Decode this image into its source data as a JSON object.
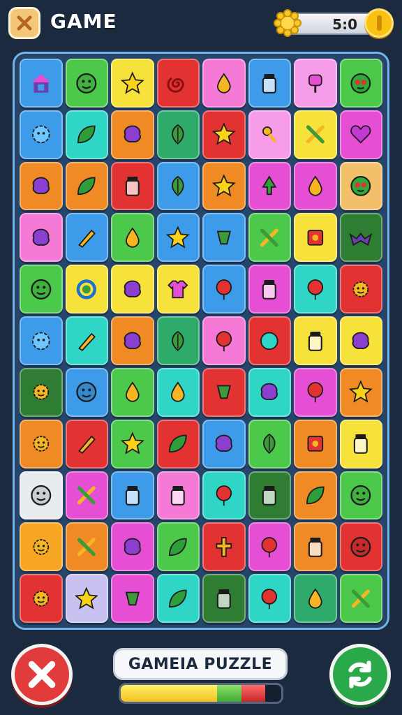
{
  "header": {
    "title": "GAME",
    "score": "5:0",
    "close_icon": "close-icon",
    "badge_icon": "gear-badge-icon",
    "coin_icon": "coin-icon"
  },
  "footer": {
    "puzzle_label": "GAMEIA PUZZLE",
    "progress": {
      "yellow": 0.6,
      "green": 0.15,
      "red": 0.15
    }
  },
  "colors": {
    "background": "#1c2a3f",
    "board": "#25456b",
    "board_border": "#6db6f0",
    "cancel": "#e23b3b",
    "refresh": "#2aa94a"
  },
  "grid": {
    "rows": 11,
    "cols": 9,
    "tiles": [
      [
        {
          "c": "#3d9be9",
          "i": "house"
        },
        {
          "c": "#4cc94a",
          "i": "face"
        },
        {
          "c": "#f7e23b",
          "i": "star"
        },
        {
          "c": "#e23232",
          "i": "swirl"
        },
        {
          "c": "#f57ad6",
          "i": "drop"
        },
        {
          "c": "#3d9be9",
          "i": "jar"
        },
        {
          "c": "#f79ce8",
          "i": "candy"
        },
        {
          "c": "#4cc94a",
          "i": "monster"
        }
      ],
      [
        {
          "c": "#3d9be9",
          "i": "gear"
        },
        {
          "c": "#2fd6c6",
          "i": "leaf"
        },
        {
          "c": "#f08a24",
          "i": "blob"
        },
        {
          "c": "#2eaa6a",
          "i": "leaf2"
        },
        {
          "c": "#e23232",
          "i": "star"
        },
        {
          "c": "#f79ce8",
          "i": "key"
        },
        {
          "c": "#f7e23b",
          "i": "tool"
        },
        {
          "c": "#e64fd3",
          "i": "heart"
        }
      ],
      [
        {
          "c": "#f08a24",
          "i": "blob"
        },
        {
          "c": "#f08a24",
          "i": "leaf"
        },
        {
          "c": "#e23232",
          "i": "jar"
        },
        {
          "c": "#3d9be9",
          "i": "leaf2"
        },
        {
          "c": "#f08a24",
          "i": "star"
        },
        {
          "c": "#e64fd3",
          "i": "tree"
        },
        {
          "c": "#e64fd3",
          "i": "drop"
        },
        {
          "c": "#f2c06a",
          "i": "monster"
        }
      ],
      [
        {
          "c": "#f57ad6",
          "i": "blob"
        },
        {
          "c": "#3d9be9",
          "i": "pencil"
        },
        {
          "c": "#4cc94a",
          "i": "drop"
        },
        {
          "c": "#3d9be9",
          "i": "star"
        },
        {
          "c": "#3d9be9",
          "i": "cup"
        },
        {
          "c": "#4cc94a",
          "i": "tool"
        },
        {
          "c": "#f7e23b",
          "i": "box"
        },
        {
          "c": "#2e7d32",
          "i": "bat"
        }
      ],
      [
        {
          "c": "#4cc94a",
          "i": "face"
        },
        {
          "c": "#f7e23b",
          "i": "ring"
        },
        {
          "c": "#f7e23b",
          "i": "blob"
        },
        {
          "c": "#f7e23b",
          "i": "shirt"
        },
        {
          "c": "#3d9be9",
          "i": "balloon"
        },
        {
          "c": "#e64fd3",
          "i": "jar"
        },
        {
          "c": "#2fd6c6",
          "i": "balloon"
        },
        {
          "c": "#e23232",
          "i": "sun"
        }
      ],
      [
        {
          "c": "#3d9be9",
          "i": "gear"
        },
        {
          "c": "#2fd6c6",
          "i": "pencil"
        },
        {
          "c": "#f08a24",
          "i": "blob"
        },
        {
          "c": "#2eaa6a",
          "i": "leaf2"
        },
        {
          "c": "#f57ad6",
          "i": "balloon"
        },
        {
          "c": "#e23232",
          "i": "ball"
        },
        {
          "c": "#f7e23b",
          "i": "jar"
        },
        {
          "c": "#f7e23b",
          "i": "blob"
        }
      ],
      [
        {
          "c": "#2e7d32",
          "i": "sun"
        },
        {
          "c": "#3d9be9",
          "i": "face"
        },
        {
          "c": "#4cc94a",
          "i": "drop"
        },
        {
          "c": "#2fd6c6",
          "i": "drop"
        },
        {
          "c": "#e23232",
          "i": "cup"
        },
        {
          "c": "#2fd6c6",
          "i": "blob"
        },
        {
          "c": "#e64fd3",
          "i": "balloon"
        },
        {
          "c": "#f08a24",
          "i": "star"
        }
      ],
      [
        {
          "c": "#f08a24",
          "i": "sun"
        },
        {
          "c": "#e23232",
          "i": "pencil"
        },
        {
          "c": "#4cc94a",
          "i": "star"
        },
        {
          "c": "#e23232",
          "i": "leaf"
        },
        {
          "c": "#3d9be9",
          "i": "blob"
        },
        {
          "c": "#4cc94a",
          "i": "leaf2"
        },
        {
          "c": "#f08a24",
          "i": "box"
        },
        {
          "c": "#f7e23b",
          "i": "jar"
        }
      ],
      [
        {
          "c": "#e8ecef",
          "i": "face"
        },
        {
          "c": "#e64fd3",
          "i": "tool"
        },
        {
          "c": "#3d9be9",
          "i": "jar"
        },
        {
          "c": "#f57ad6",
          "i": "jar"
        },
        {
          "c": "#2fd6c6",
          "i": "balloon"
        },
        {
          "c": "#2e7d32",
          "i": "jar"
        },
        {
          "c": "#f08a24",
          "i": "leaf"
        },
        {
          "c": "#4cc94a",
          "i": "face"
        }
      ],
      [
        {
          "c": "#f7a623",
          "i": "sun"
        },
        {
          "c": "#f08a24",
          "i": "tool"
        },
        {
          "c": "#e64fd3",
          "i": "blob"
        },
        {
          "c": "#4cc94a",
          "i": "leaf"
        },
        {
          "c": "#e23232",
          "i": "cross"
        },
        {
          "c": "#e64fd3",
          "i": "balloon"
        },
        {
          "c": "#f08a24",
          "i": "jar"
        },
        {
          "c": "#e23232",
          "i": "face"
        }
      ],
      [
        {
          "c": "#e23232",
          "i": "sun"
        },
        {
          "c": "#c9c2f0",
          "i": "star"
        },
        {
          "c": "#e64fd3",
          "i": "cup"
        },
        {
          "c": "#2fd6c6",
          "i": "leaf"
        },
        {
          "c": "#2e7d32",
          "i": "jar"
        },
        {
          "c": "#2fd6c6",
          "i": "balloon"
        },
        {
          "c": "#2eaa6a",
          "i": "drop"
        },
        {
          "c": "#4cc94a",
          "i": "tool"
        }
      ]
    ]
  }
}
